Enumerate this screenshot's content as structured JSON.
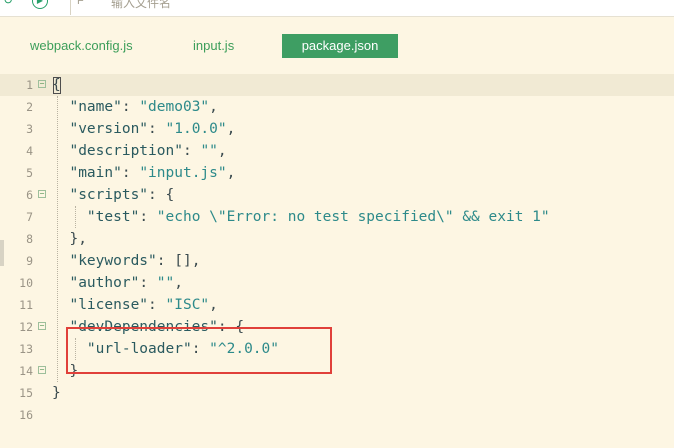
{
  "toolbar": {
    "icon_a": "↻",
    "icon_b": "▶",
    "search_icon": "F",
    "search_placeholder": "输入文件名"
  },
  "tabs": [
    {
      "label": "webpack.config.js",
      "active": false
    },
    {
      "label": "input.js",
      "active": false
    },
    {
      "label": "package.json",
      "active": true
    }
  ],
  "editor": {
    "lines": [
      {
        "n": "1",
        "fold": "−",
        "tokens": [
          {
            "t": "{",
            "c": "p"
          }
        ]
      },
      {
        "n": "2",
        "fold": "",
        "tokens": [
          {
            "t": "  ",
            "c": "p"
          },
          {
            "t": "\"name\"",
            "c": "k"
          },
          {
            "t": ": ",
            "c": "p"
          },
          {
            "t": "\"demo03\"",
            "c": "s"
          },
          {
            "t": ",",
            "c": "p"
          }
        ]
      },
      {
        "n": "3",
        "fold": "",
        "tokens": [
          {
            "t": "  ",
            "c": "p"
          },
          {
            "t": "\"version\"",
            "c": "k"
          },
          {
            "t": ": ",
            "c": "p"
          },
          {
            "t": "\"1.0.0\"",
            "c": "s"
          },
          {
            "t": ",",
            "c": "p"
          }
        ]
      },
      {
        "n": "4",
        "fold": "",
        "tokens": [
          {
            "t": "  ",
            "c": "p"
          },
          {
            "t": "\"description\"",
            "c": "k"
          },
          {
            "t": ": ",
            "c": "p"
          },
          {
            "t": "\"\"",
            "c": "s"
          },
          {
            "t": ",",
            "c": "p"
          }
        ]
      },
      {
        "n": "5",
        "fold": "",
        "tokens": [
          {
            "t": "  ",
            "c": "p"
          },
          {
            "t": "\"main\"",
            "c": "k"
          },
          {
            "t": ": ",
            "c": "p"
          },
          {
            "t": "\"input.js\"",
            "c": "s"
          },
          {
            "t": ",",
            "c": "p"
          }
        ]
      },
      {
        "n": "6",
        "fold": "−",
        "tokens": [
          {
            "t": "  ",
            "c": "p"
          },
          {
            "t": "\"scripts\"",
            "c": "k"
          },
          {
            "t": ": {",
            "c": "p"
          }
        ]
      },
      {
        "n": "7",
        "fold": "",
        "tokens": [
          {
            "t": "    ",
            "c": "p"
          },
          {
            "t": "\"test\"",
            "c": "k"
          },
          {
            "t": ": ",
            "c": "p"
          },
          {
            "t": "\"echo \\\"Error: no test specified\\\" && exit 1\"",
            "c": "s"
          }
        ]
      },
      {
        "n": "8",
        "fold": "",
        "tokens": [
          {
            "t": "  },",
            "c": "p"
          }
        ]
      },
      {
        "n": "9",
        "fold": "",
        "tokens": [
          {
            "t": "  ",
            "c": "p"
          },
          {
            "t": "\"keywords\"",
            "c": "k"
          },
          {
            "t": ": [],",
            "c": "p"
          }
        ]
      },
      {
        "n": "10",
        "fold": "",
        "tokens": [
          {
            "t": "  ",
            "c": "p"
          },
          {
            "t": "\"author\"",
            "c": "k"
          },
          {
            "t": ": ",
            "c": "p"
          },
          {
            "t": "\"\"",
            "c": "s"
          },
          {
            "t": ",",
            "c": "p"
          }
        ]
      },
      {
        "n": "11",
        "fold": "",
        "tokens": [
          {
            "t": "  ",
            "c": "p"
          },
          {
            "t": "\"license\"",
            "c": "k"
          },
          {
            "t": ": ",
            "c": "p"
          },
          {
            "t": "\"ISC\"",
            "c": "s"
          },
          {
            "t": ",",
            "c": "p"
          }
        ]
      },
      {
        "n": "12",
        "fold": "−",
        "tokens": [
          {
            "t": "  ",
            "c": "p"
          },
          {
            "t": "\"devDependencies\"",
            "c": "k"
          },
          {
            "t": ": {",
            "c": "p"
          }
        ]
      },
      {
        "n": "13",
        "fold": "",
        "tokens": [
          {
            "t": "    ",
            "c": "p"
          },
          {
            "t": "\"url-loader\"",
            "c": "k"
          },
          {
            "t": ": ",
            "c": "p"
          },
          {
            "t": "\"^2.0.0\"",
            "c": "s"
          }
        ]
      },
      {
        "n": "14",
        "fold": "−",
        "tokens": [
          {
            "t": "  }",
            "c": "p"
          }
        ]
      },
      {
        "n": "15",
        "fold": "",
        "tokens": [
          {
            "t": "}",
            "c": "p"
          }
        ]
      },
      {
        "n": "16",
        "fold": "",
        "tokens": []
      }
    ]
  },
  "colors": {
    "editor_bg": "#fdf6e3",
    "tab_active_bg": "#3e9e63",
    "tab_text": "#3c9e5a",
    "highlight_border": "#e0403a"
  }
}
